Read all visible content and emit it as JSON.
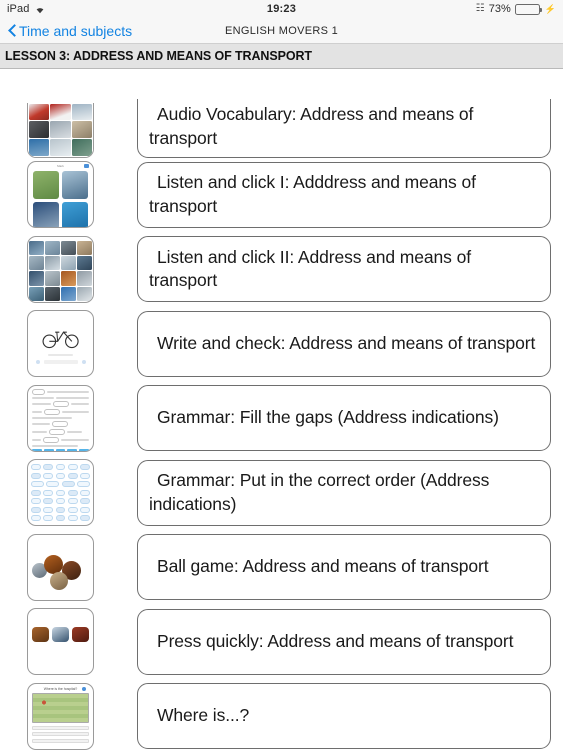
{
  "status_bar": {
    "device": "iPad",
    "wifi_icon": "wifi-icon",
    "time": "19:23",
    "bluetooth_icon": "bluetooth-icon",
    "battery_percent": "73%",
    "battery_level": 73,
    "charging_icon": "charging-bolt-icon"
  },
  "nav_bar": {
    "back_icon": "chevron-left-icon",
    "back_label": "Time and subjects",
    "title": "ENGLISH MOVERS 1",
    "tint_color": "#1283e2"
  },
  "section": {
    "header": "LESSON 3: ADDRESS AND MEANS OF TRANSPORT",
    "background": "#e3e3e3"
  },
  "activities": [
    {
      "label": "Audio Vocabulary: Address and means of transport",
      "thumbnail": "photo-grid-3x3-thumbnail",
      "thumb_type": "grid3"
    },
    {
      "label": "Listen and click I: Adddress and means of transport",
      "thumbnail": "photo-grid-2x2-thumbnail",
      "thumb_type": "grid2"
    },
    {
      "label": "Listen and click II: Address and means of transport",
      "thumbnail": "photo-grid-4x4-thumbnail",
      "thumb_type": "grid4"
    },
    {
      "label": "Write and check: Address and means of transport",
      "thumbnail": "bicycle-drawing-thumbnail",
      "thumb_type": "bike"
    },
    {
      "label": "Grammar: Fill the gaps (Address indications)",
      "thumbnail": "worksheet-fill-gaps-thumbnail",
      "thumb_type": "worksheet"
    },
    {
      "label": "Grammar: Put in the correct order (Address indications)",
      "thumbnail": "word-pills-grid-thumbnail",
      "thumb_type": "pills"
    },
    {
      "label": "Ball game: Address and means of transport",
      "thumbnail": "circular-balls-thumbnail",
      "thumb_type": "balls"
    },
    {
      "label": "Press quickly: Address and means of transport",
      "thumbnail": "three-photos-row-thumbnail",
      "thumb_type": "prow"
    },
    {
      "label": "Where is...?",
      "thumbnail": "town-map-thumbnail",
      "thumb_type": "map"
    }
  ]
}
